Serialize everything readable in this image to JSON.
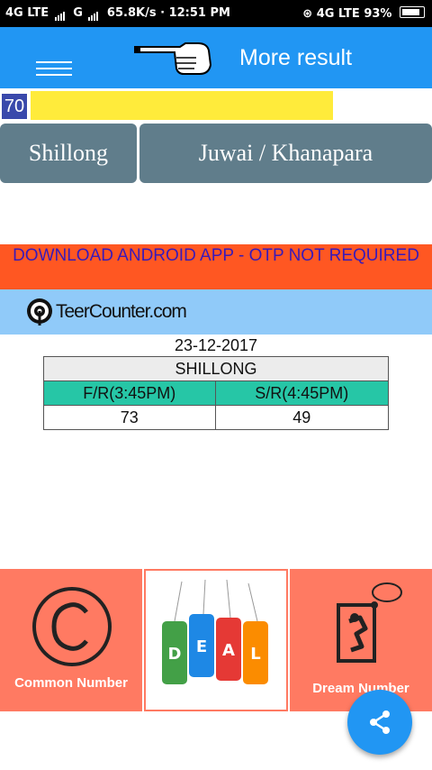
{
  "status": {
    "network1": "4G LTE",
    "network2": "G",
    "speed": "65.8K/s",
    "time": "12:51 PM",
    "network3": "4G LTE",
    "battery": "93%"
  },
  "appbar": {
    "more_result": "More result"
  },
  "counter": {
    "number": "70"
  },
  "buttons": {
    "shillong": "Shillong",
    "juwai": "Juwai / Khanapara"
  },
  "banner": {
    "text": "DOWNLOAD ANDROID APP - OTP NOT REQUIRED"
  },
  "teer": {
    "brand": "TeerCounter.com"
  },
  "results": {
    "date": "23-12-2017",
    "title": "SHILLONG",
    "headers": [
      "F/R(3:45PM)",
      "S/R(4:45PM)"
    ],
    "values": [
      "73",
      "49"
    ]
  },
  "tiles": {
    "common": "Common Number",
    "deal_letters": [
      "D",
      "E",
      "A",
      "L"
    ],
    "dream": "Dream Number"
  },
  "colors": {
    "primary": "#2196f3",
    "yellow": "#ffeb3b",
    "slate": "#607d8b",
    "orange": "#ff5722",
    "teal": "#26c6a6",
    "coral": "#ff7a62"
  }
}
